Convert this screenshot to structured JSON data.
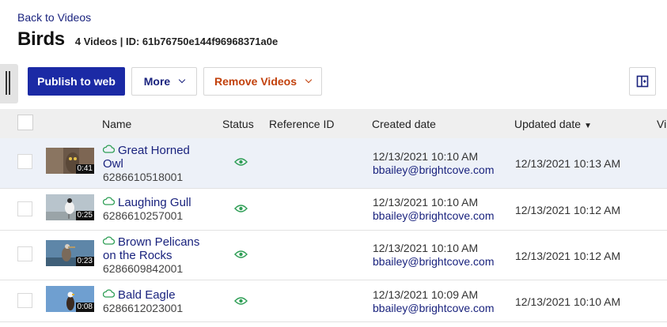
{
  "nav": {
    "back_label": "Back to Videos"
  },
  "header": {
    "title": "Birds",
    "meta": "4 Videos | ID: 61b76750e144f96968371a0e"
  },
  "toolbar": {
    "publish_label": "Publish to web",
    "more_label": "More",
    "remove_label": "Remove Videos",
    "layout_icon": "layout-toggle-icon"
  },
  "colors": {
    "primary": "#1b2aa5",
    "link": "#1a237e",
    "danger": "#c2410c",
    "status_green": "#2e9e55",
    "selected_row": "#edf1f8"
  },
  "table": {
    "columns": [
      "Name",
      "Status",
      "Reference ID",
      "Created date",
      "Updated date",
      "Vi"
    ],
    "sorted_column": "Updated date",
    "sort_direction": "descending",
    "rows": [
      {
        "name_line1": "Great Horned",
        "name_line2": "Owl",
        "id": "6286610518001",
        "duration": "0:41",
        "status_icon": "eye-icon",
        "reference_id": "",
        "created": "12/13/2021 10:10 AM",
        "created_by": "bbailey@brightcove.com",
        "updated": "12/13/2021 10:13 AM",
        "selected": true
      },
      {
        "name_line1": "Laughing Gull",
        "name_line2": "",
        "id": "6286610257001",
        "duration": "0:25",
        "status_icon": "eye-icon",
        "reference_id": "",
        "created": "12/13/2021 10:10 AM",
        "created_by": "bbailey@brightcove.com",
        "updated": "12/13/2021 10:12 AM",
        "selected": false
      },
      {
        "name_line1": "Brown Pelicans",
        "name_line2": "on the Rocks",
        "id": "6286609842001",
        "duration": "0:23",
        "status_icon": "eye-icon",
        "reference_id": "",
        "created": "12/13/2021 10:10 AM",
        "created_by": "bbailey@brightcove.com",
        "updated": "12/13/2021 10:12 AM",
        "selected": false
      },
      {
        "name_line1": "Bald Eagle",
        "name_line2": "",
        "id": "6286612023001",
        "duration": "0:08",
        "status_icon": "eye-icon",
        "reference_id": "",
        "created": "12/13/2021 10:09 AM",
        "created_by": "bbailey@brightcove.com",
        "updated": "12/13/2021 10:10 AM",
        "selected": false
      }
    ]
  }
}
